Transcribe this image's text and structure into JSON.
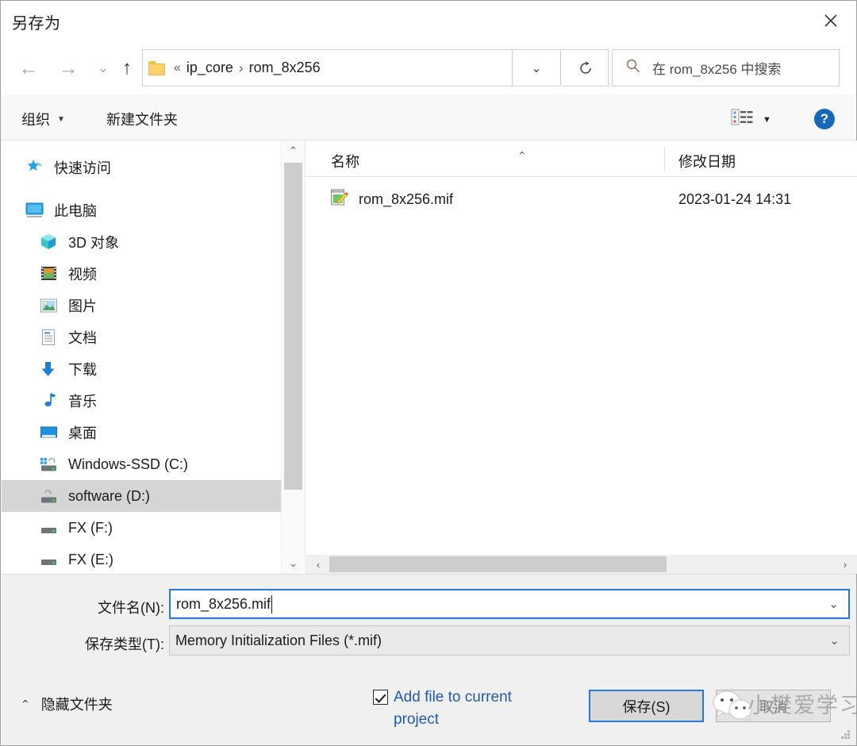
{
  "dialog": {
    "title": "另存为",
    "close_icon": "close-icon"
  },
  "nav": {
    "back_icon": "←",
    "forward_icon": "→",
    "history_icon": "⌄",
    "up_icon": "↑",
    "breadcrumb": {
      "folder_icon": "folder-icon",
      "overflow": "«",
      "items": [
        "ip_core",
        "rom_8x256"
      ],
      "separator": "›"
    },
    "breadcrumb_dropdown_icon": "⌄",
    "refresh_icon": "↻",
    "search": {
      "placeholder": "在 rom_8x256 中搜索",
      "icon": "search-icon"
    }
  },
  "toolbar": {
    "organize": "组织",
    "organize_caret": "▼",
    "new_folder": "新建文件夹",
    "view_icon": "list-view-icon",
    "view_caret": "▼",
    "help": "?"
  },
  "sidebar": {
    "items": [
      {
        "label": "快速访问",
        "icon": "star-pin-icon",
        "indent": false,
        "selected": false
      },
      {
        "label": "此电脑",
        "icon": "computer-icon",
        "indent": false,
        "selected": false
      },
      {
        "label": "3D 对象",
        "icon": "cube-icon",
        "indent": true,
        "selected": false
      },
      {
        "label": "视频",
        "icon": "video-icon",
        "indent": true,
        "selected": false
      },
      {
        "label": "图片",
        "icon": "picture-icon",
        "indent": true,
        "selected": false
      },
      {
        "label": "文档",
        "icon": "document-icon",
        "indent": true,
        "selected": false
      },
      {
        "label": "下载",
        "icon": "download-icon",
        "indent": true,
        "selected": false
      },
      {
        "label": "音乐",
        "icon": "music-icon",
        "indent": true,
        "selected": false
      },
      {
        "label": "桌面",
        "icon": "desktop-icon",
        "indent": true,
        "selected": false
      },
      {
        "label": "Windows-SSD (C:)",
        "icon": "system-drive-icon",
        "indent": true,
        "selected": false
      },
      {
        "label": "software (D:)",
        "icon": "drive-icon",
        "indent": true,
        "selected": true
      },
      {
        "label": "FX (F:)",
        "icon": "drive-icon",
        "indent": true,
        "selected": false
      },
      {
        "label": "FX (E:)",
        "icon": "drive-icon",
        "indent": true,
        "selected": false
      }
    ],
    "scroll_up_icon": "⌃",
    "scroll_down_icon": "⌄"
  },
  "files": {
    "columns": {
      "name": "名称",
      "name_sort_icon": "⌃",
      "date": "修改日期"
    },
    "rows": [
      {
        "name": "rom_8x256.mif",
        "date": "2023-01-24 14:31",
        "icon": "mif-file-icon"
      }
    ],
    "hscroll_left_icon": "‹",
    "hscroll_right_icon": "›"
  },
  "footer": {
    "filename_label": "文件名(N):",
    "filename_value": "rom_8x256.mif",
    "filetype_label": "保存类型(T):",
    "filetype_value": "Memory Initialization Files (*.mif)",
    "combo_arrow_icon": "⌄",
    "checkbox_label": "Add file to current project",
    "checkbox_checked": true,
    "save_button": "保存(S)",
    "cancel_button": "取消",
    "hide_folders_caret": "⌃",
    "hide_folders": "隐藏文件夹"
  },
  "watermark": {
    "text": "小樊爱学习",
    "logo": "wechat-icon"
  },
  "colors": {
    "accent": "#2579da",
    "link": "#2159b0",
    "toolbar_bg": "#f8f8f8",
    "footer_bg": "#f0f0f0",
    "selection": "#d5d5d5"
  }
}
